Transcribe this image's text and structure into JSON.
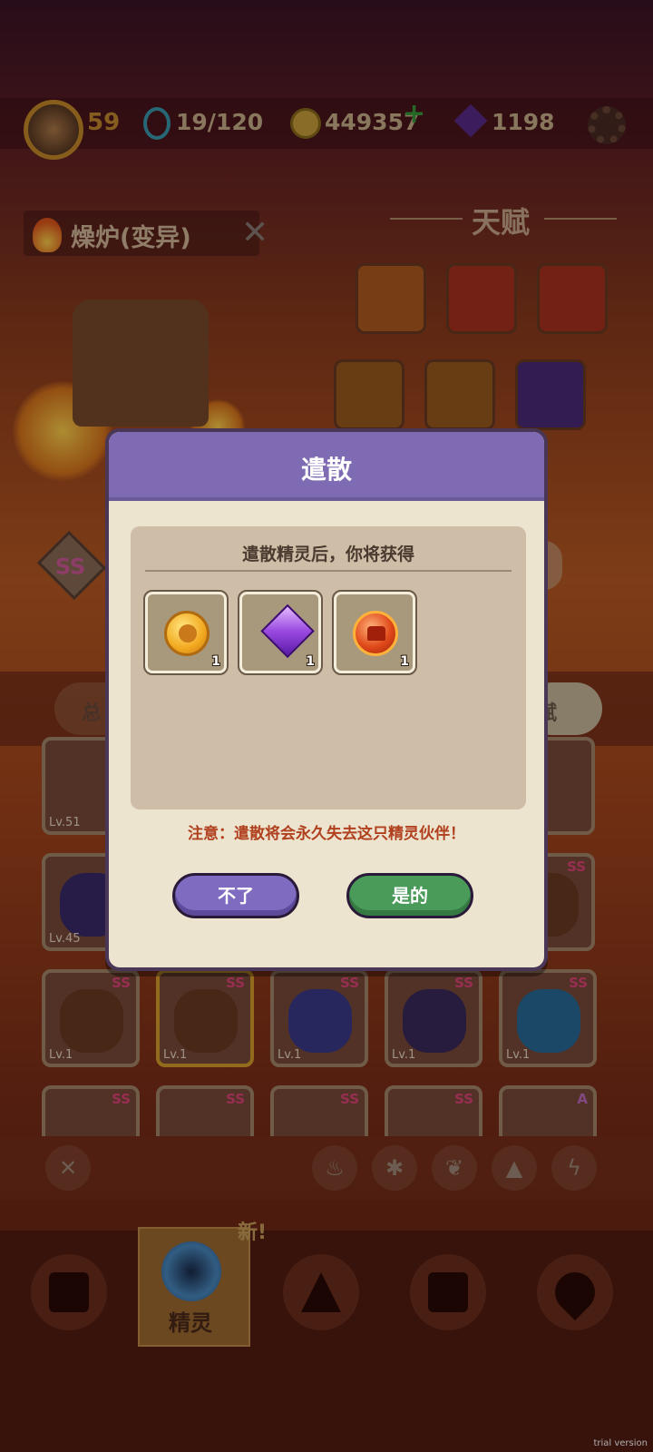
{
  "topbar": {
    "level": "59",
    "stamina": "19/120",
    "coins": "449357",
    "gems": "1198"
  },
  "monster": {
    "name": "燥炉(变异)",
    "grade": "SS"
  },
  "talent": {
    "title": "天赋"
  },
  "tabs": {
    "left_label": "总",
    "right_label": "赋"
  },
  "grid": {
    "row1": [
      "Lv.51"
    ],
    "row2": [
      "Lv.45"
    ],
    "row3": [
      {
        "lv": "Lv.1",
        "grade": "SS"
      },
      {
        "lv": "Lv.1",
        "grade": "SS"
      },
      {
        "lv": "Lv.1",
        "grade": "SS"
      },
      {
        "lv": "Lv.1",
        "grade": "SS"
      },
      {
        "lv": "Lv.1",
        "grade": "SS"
      }
    ],
    "row4": [
      {
        "grade": "SS"
      },
      {
        "grade": "SS"
      },
      {
        "grade": "SS"
      },
      {
        "grade": "SS"
      },
      {
        "grade": "A"
      }
    ],
    "row2_right_grade": "SS"
  },
  "bottom_nav": {
    "active_label": "精灵",
    "new_badge": "新!"
  },
  "modal": {
    "title": "遣散",
    "caption": "遣散精灵后，你将获得",
    "rewards": [
      {
        "icon": "coin-icon",
        "count": "1"
      },
      {
        "icon": "purple-gem-icon",
        "count": "1"
      },
      {
        "icon": "red-core-icon",
        "count": "1"
      }
    ],
    "warning": "注意：遣散将会永久失去这只精灵伙伴！",
    "cancel_label": "不了",
    "confirm_label": "是的"
  },
  "watermark": "trial version",
  "colors": {
    "modal_header": "#7f6bb3",
    "confirm": "#4a9a5a",
    "cancel": "#7f6bc0",
    "warning": "#b0401e"
  }
}
